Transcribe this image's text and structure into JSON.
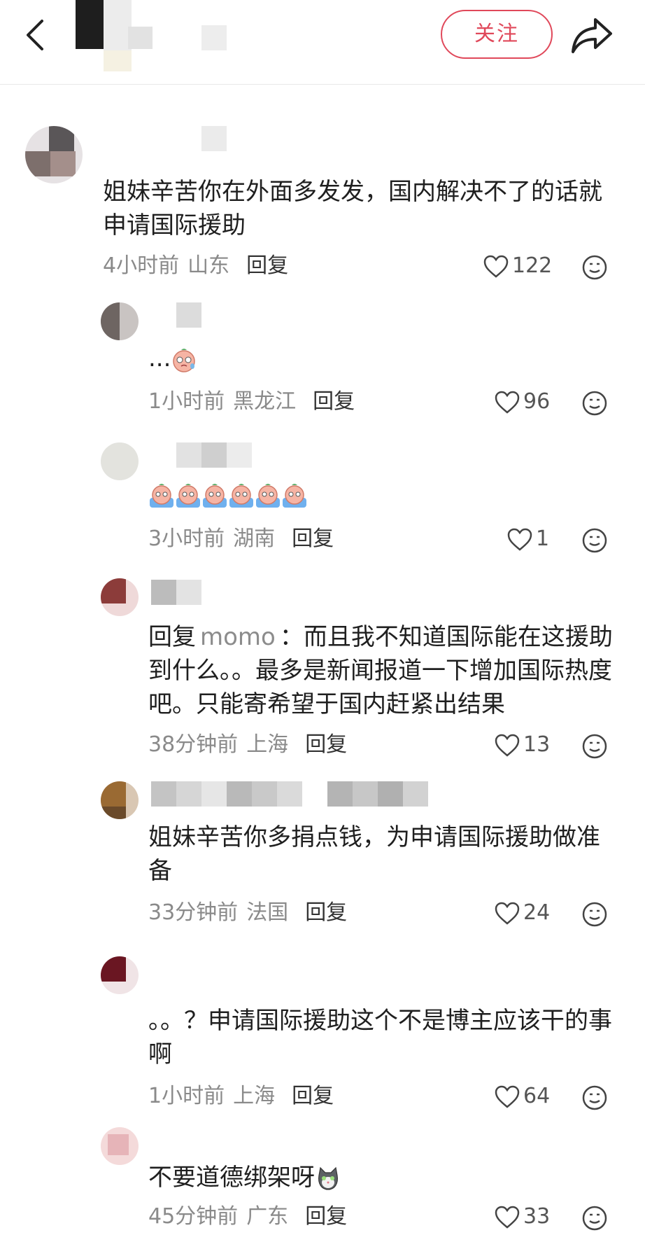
{
  "topbar": {
    "follow_label": "关注"
  },
  "comments": [
    {
      "text": "姐妹辛苦你在外面多发发，国内解决不了的话就申请国际援助",
      "time": "4小时前",
      "location": "山东",
      "reply_label": "回复",
      "likes": "122"
    },
    {
      "text": "...",
      "time": "1小时前",
      "location": "黑龙江",
      "reply_label": "回复",
      "likes": "96"
    },
    {
      "text": "",
      "time": "3小时前",
      "location": "湖南",
      "reply_label": "回复",
      "likes": "1"
    },
    {
      "reply_prefix": "回复",
      "mention": "momo",
      "text": "：而且我不知道国际能在这援助到什么。。最多是新闻报道一下增加国际热度吧。只能寄希望于国内赶紧出结果",
      "time": "38分钟前",
      "location": "上海",
      "reply_label": "回复",
      "likes": "13"
    },
    {
      "text": "姐妹辛苦你多捐点钱，为申请国际援助做准备",
      "time": "33分钟前",
      "location": "法国",
      "reply_label": "回复",
      "likes": "24"
    },
    {
      "text": "。。？申请国际援助这个不是博主应该干的事啊",
      "time": "1小时前",
      "location": "上海",
      "reply_label": "回复",
      "likes": "64"
    },
    {
      "text": "不要道德绑架呀",
      "time": "45分钟前",
      "location": "广东",
      "reply_label": "回复",
      "likes": "33"
    }
  ],
  "icons": {
    "back": "chevron-left-icon",
    "share": "share-arrow-icon",
    "like": "heart-outline-icon",
    "emoji": "smiley-face-icon"
  },
  "colors": {
    "accent": "#e0485a",
    "meta": "#8a8a8a"
  }
}
